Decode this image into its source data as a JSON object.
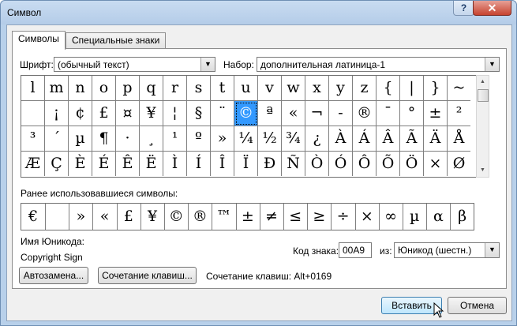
{
  "window": {
    "title": "Символ",
    "help_label": "?",
    "close_label": "✕"
  },
  "tabs": [
    {
      "label": "Символы"
    },
    {
      "label": "Специальные знаки"
    }
  ],
  "font": {
    "label": "Шрифт:",
    "value": "(обычный текст)"
  },
  "subset": {
    "label": "Набор:",
    "value": "дополнительная латиница-1"
  },
  "symbols": [
    [
      "l",
      "m",
      "n",
      "o",
      "p",
      "q",
      "r",
      "s",
      "t",
      "u",
      "v",
      "w",
      "x",
      "y",
      "z",
      "{",
      "|",
      "}",
      "~"
    ],
    [
      "",
      "¡",
      "¢",
      "£",
      "¤",
      "¥",
      "¦",
      "§",
      "¨",
      "©",
      "ª",
      "«",
      "¬",
      "-",
      "®",
      "¯",
      "°",
      "±",
      "²"
    ],
    [
      "³",
      "´",
      "µ",
      "¶",
      "·",
      "¸",
      "¹",
      "º",
      "»",
      "¼",
      "½",
      "¾",
      "¿",
      "À",
      "Á",
      "Â",
      "Ã",
      "Ä",
      "Å"
    ],
    [
      "Æ",
      "Ç",
      "È",
      "É",
      "Ê",
      "Ë",
      "Ì",
      "Í",
      "Î",
      "Ï",
      "Ð",
      "Ñ",
      "Ò",
      "Ó",
      "Ô",
      "Õ",
      "Ö",
      "×",
      "Ø"
    ]
  ],
  "selected": {
    "row": 1,
    "col": 9,
    "accent": "#3399ff"
  },
  "recent": {
    "label": "Ранее использовавшиеся символы:",
    "items": [
      "€",
      "",
      "»",
      "«",
      "£",
      "¥",
      "©",
      "®",
      "™",
      "±",
      "≠",
      "≤",
      "≥",
      "÷",
      "×",
      "∞",
      "µ",
      "α",
      "β"
    ]
  },
  "unicode_name": {
    "label": "Имя Юникода:",
    "value": "Copyright Sign"
  },
  "char_code": {
    "label": "Код знака:",
    "value": "00A9"
  },
  "from": {
    "label": "из:",
    "value": "Юникод (шестн.)"
  },
  "buttons": {
    "autocorrect": "Автозамена...",
    "shortcut_key": "Сочетание клавиш...",
    "insert": "Вставить",
    "cancel": "Отмена"
  },
  "shortcut_text": "Сочетание клавиш: Alt+0169"
}
